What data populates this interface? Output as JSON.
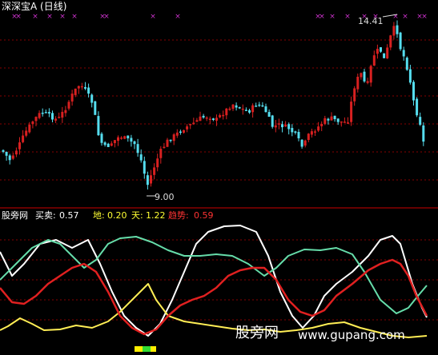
{
  "upper_panel": {
    "title": "深深宝A (日线)",
    "high_label": "14.41",
    "low_label": "9.00",
    "marker_glyph": "×"
  },
  "lower_panel": {
    "site_label": "股旁网",
    "indicators": [
      {
        "label": "买卖:",
        "value": "0.57",
        "color": "#ffffff"
      },
      {
        "label": "地:",
        "value": "0.20",
        "color": "#ffff33"
      },
      {
        "label": "天:",
        "value": "1.22",
        "color": "#ffff33"
      },
      {
        "label": "趋势:",
        "value": "0.59",
        "color": "#ff3333"
      }
    ]
  },
  "watermark": {
    "cn": "股旁网",
    "url": "www.gupang.com"
  },
  "colors": {
    "background": "#000000",
    "rise": "#d82020",
    "fall": "#55ddee",
    "grid": "#880000",
    "divider": "#cc0000",
    "marker": "#cc33cc",
    "line_buy_sell": "#ffffff",
    "line_sky": "#66ddaa",
    "line_earth": "#ffee55",
    "line_trend": "#e02020"
  },
  "chart_data": {
    "type": "candlestick",
    "price_high": 14.41,
    "price_low": 9.0
  }
}
